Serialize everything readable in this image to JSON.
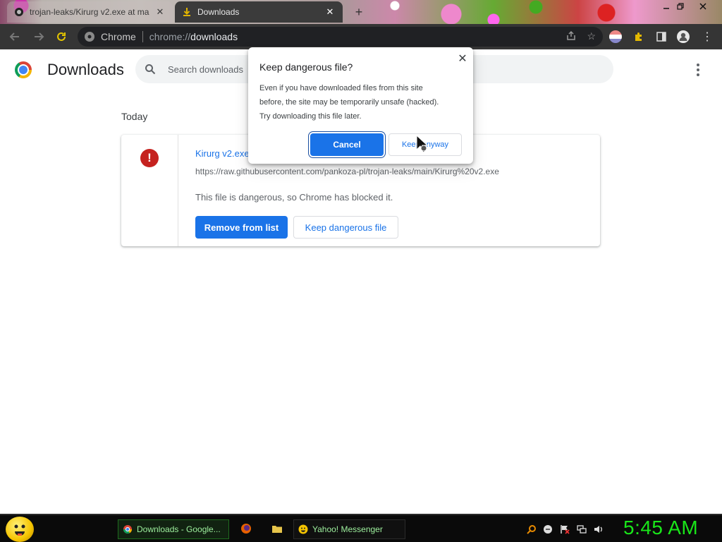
{
  "browser": {
    "tabs": [
      {
        "label": "trojan-leaks/Kirurg v2.exe at ma",
        "active": false,
        "icon": "github-icon"
      },
      {
        "label": "Downloads",
        "active": true,
        "icon": "download-icon"
      }
    ],
    "new_tab_symbol": "+",
    "omnibox": {
      "site_label": "Chrome",
      "url_prefix": "chrome://",
      "url_path": "downloads"
    }
  },
  "downloads_page": {
    "title": "Downloads",
    "search_placeholder": "Search downloads",
    "section_label": "Today",
    "item": {
      "filename": "Kirurg v2.exe",
      "url": "https://raw.githubusercontent.com/pankoza-pl/trojan-leaks/main/Kirurg%20v2.exe",
      "status": "This file is dangerous, so Chrome has blocked it.",
      "remove_button": "Remove from list",
      "keep_button": "Keep dangerous file"
    }
  },
  "dialog": {
    "title": "Keep dangerous file?",
    "body_lines": [
      "Even if you have downloaded files from this site",
      "before, the site may be temporarily unsafe (hacked).",
      "Try downloading this file later."
    ],
    "cancel_button": "Cancel",
    "keep_anyway_button": "Keep anyway"
  },
  "taskbar": {
    "tasks": [
      {
        "label": "Downloads - Google...",
        "icon": "chrome-icon"
      },
      {
        "label": "Yahoo! Messenger",
        "icon": "yahoo-messenger-icon"
      }
    ],
    "quick_launch": [
      "firefox-icon",
      "folder-icon"
    ],
    "clock": "5:45 AM"
  },
  "colors": {
    "accent_blue": "#1a73e8",
    "danger_red": "#c5221f",
    "clock_green": "#19e619"
  }
}
